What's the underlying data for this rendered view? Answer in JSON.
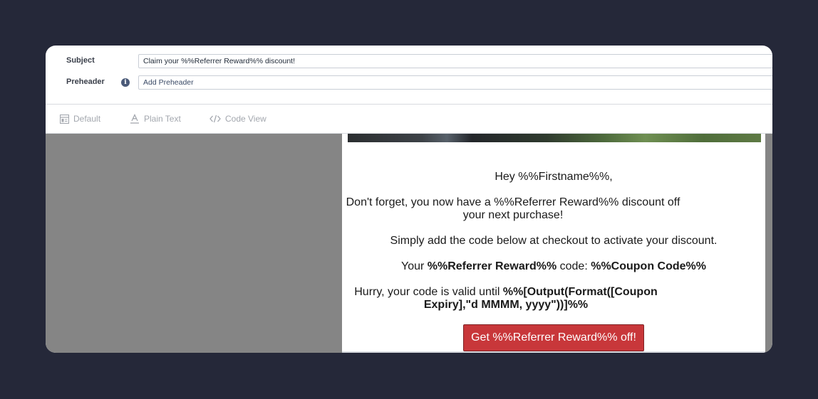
{
  "fields": {
    "subject": {
      "label": "Subject",
      "value": "Claim your %%Referrer Reward%% discount!"
    },
    "preheader": {
      "label": "Preheader",
      "value": "Add Preheader",
      "info_icon": "info-icon"
    }
  },
  "toolbar": {
    "default_label": "Default",
    "plain_text_label": "Plain Text",
    "code_view_label": "Code View"
  },
  "email": {
    "greeting": "Hey %%Firstname%%,",
    "reminder": "Don't forget, you now have a %%Referrer Reward%% discount off your next purchase!",
    "instruction": "Simply add the code below at checkout to activate your discount.",
    "code_line": {
      "prefix": "Your ",
      "reward": "%%Referrer Reward%%",
      "middle": " code: ",
      "coupon": "%%Coupon Code%%"
    },
    "expiry_line": {
      "prefix": "Hurry, your code is valid until ",
      "expiry": "%%[Output(Format([Coupon Expiry],\"d MMMM, yyyy\"))]%%"
    },
    "cta_label": "Get %%Referrer Reward%% off!"
  },
  "colors": {
    "page_bg": "#252839",
    "canvas_bg": "#858585",
    "cta_bg": "#c8373a",
    "info_icon": "#4a5a78"
  }
}
